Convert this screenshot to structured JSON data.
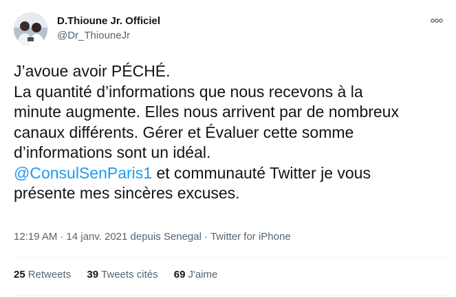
{
  "user": {
    "display_name": "D.Thioune Jr. Officiel",
    "handle": "@Dr_ThiouneJr",
    "avatar_icon": "profile-photo"
  },
  "tweet": {
    "lines": [
      {
        "text": "J’avoue avoir PÉCHÉ."
      },
      {
        "text": "La quantité d’informations que nous recevons à la"
      },
      {
        "text": "minute augmente. Elles nous arrivent par de nombreux"
      },
      {
        "text": "canaux différents. Gérer et Évaluer cette somme"
      },
      {
        "text": "d’informations sont un idéal."
      }
    ],
    "mention": "@ConsulSenParis1",
    "after_mention": " et communauté Twitter je vous",
    "last_line": "présente mes sincères excuses."
  },
  "meta": {
    "time": "12:19 AM",
    "date": "14 janv. 2021",
    "location": "depuis Senegal",
    "source": "Twitter for iPhone",
    "separator": "·"
  },
  "stats": {
    "retweets_count": "25",
    "retweets_label": "Retweets",
    "quotes_count": "39",
    "quotes_label": "Tweets cités",
    "likes_count": "69",
    "likes_label": "J'aime"
  },
  "colors": {
    "link": "#1d9bf0",
    "secondary_text": "#536471",
    "primary_text": "#0f1419",
    "divider": "#eff3f4"
  }
}
